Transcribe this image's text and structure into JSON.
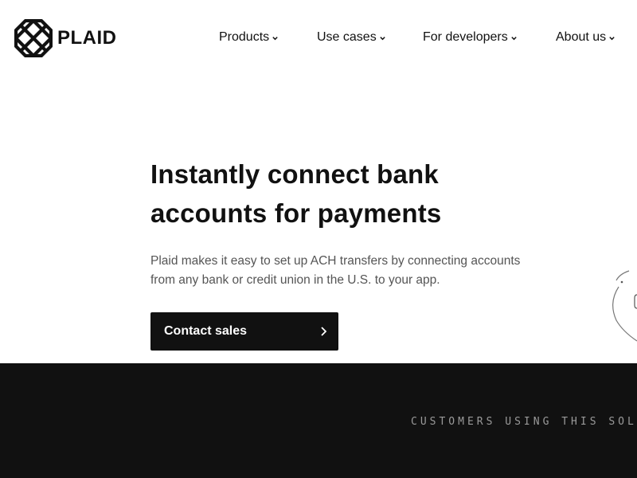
{
  "header": {
    "logo_text": "PLAID",
    "nav": [
      {
        "label": "Products",
        "icon": "chevron-down-icon"
      },
      {
        "label": "Use cases",
        "icon": "chevron-down-icon"
      },
      {
        "label": "For developers",
        "icon": "chevron-down-icon"
      },
      {
        "label": "About us",
        "icon": "chevron-down-icon"
      }
    ]
  },
  "hero": {
    "title_line1": "Instantly connect bank",
    "title_line2": "accounts for payments",
    "subtitle": "Plaid makes it easy to set up ACH transfers by connecting accounts from any bank or credit union in the U.S. to your app.",
    "cta_label": "Contact sales",
    "cta_icon": "chevron-right-icon"
  },
  "customers_section": {
    "label": "CUSTOMERS USING THIS SOLUT"
  },
  "colors": {
    "text": "#111111",
    "subtext": "#555555",
    "dark_band": "#111111",
    "mono_label": "#9a9a9a"
  }
}
